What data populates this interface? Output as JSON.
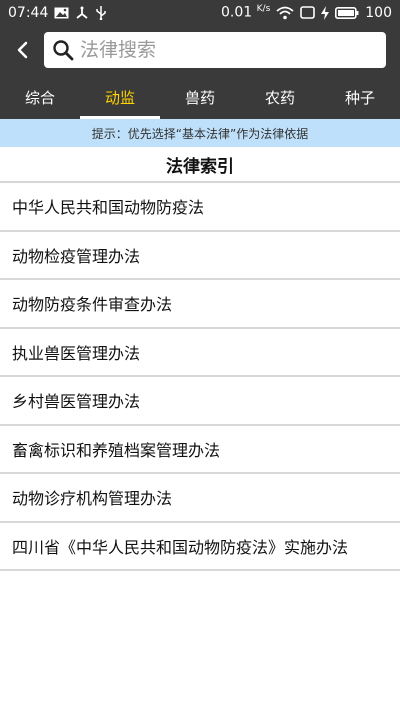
{
  "status_bar": {
    "time": "07:44",
    "net_speed": "0.01",
    "net_speed_unit": "K/s",
    "battery_level": "100",
    "icons": [
      "image-icon",
      "usb-debug-icon",
      "usb-icon",
      "wifi-icon",
      "screen-icon",
      "charging-icon",
      "battery-icon"
    ]
  },
  "header": {
    "search_placeholder": "法律搜索"
  },
  "tabs": [
    {
      "label": "综合",
      "active": false
    },
    {
      "label": "动监",
      "active": true
    },
    {
      "label": "兽药",
      "active": false
    },
    {
      "label": "农药",
      "active": false
    },
    {
      "label": "种子",
      "active": false
    }
  ],
  "tip": "提示：优先选择“基本法律”作为法律依据",
  "index_title": "法律索引",
  "items": [
    "中华人民共和国动物防疫法",
    "动物检疫管理办法",
    "动物防疫条件审查办法",
    "执业兽医管理办法",
    "乡村兽医管理办法",
    "畜禽标识和养殖档案管理办法",
    "动物诊疗机构管理办法",
    "四川省《中华人民共和国动物防疫法》实施办法"
  ],
  "colors": {
    "header_bg": "#3a3a3a",
    "active_tab": "#ffd200",
    "tip_bg": "#bfe0fa"
  }
}
